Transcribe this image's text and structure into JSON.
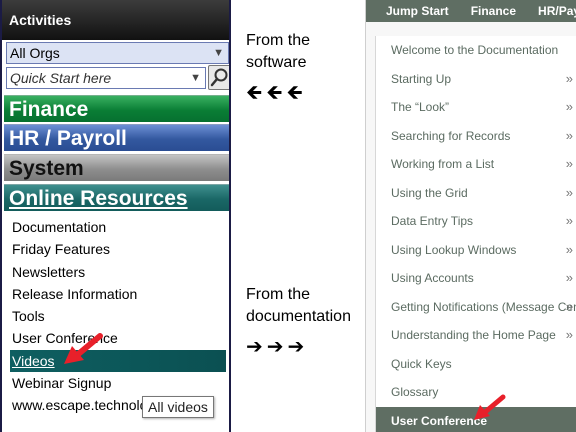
{
  "software": {
    "header_title": "Activities",
    "org_select_value": "All Orgs",
    "quick_start_placeholder": "Quick Start here",
    "categories": [
      {
        "label": "Finance"
      },
      {
        "label": "HR / Payroll"
      },
      {
        "label": "System"
      },
      {
        "label": "Online Resources"
      }
    ],
    "resources": [
      {
        "label": "Documentation"
      },
      {
        "label": "Friday Features"
      },
      {
        "label": "Newsletters"
      },
      {
        "label": "Release Information"
      },
      {
        "label": "Tools"
      },
      {
        "label": "User Conference"
      },
      {
        "label": "Videos",
        "selected": true
      },
      {
        "label": "Webinar Signup"
      },
      {
        "label": "www.escape.technology"
      }
    ],
    "tooltip": "All videos",
    "colors": {
      "finance": "#0a7e35",
      "hr": "#33589f",
      "system": "#8e8e8e",
      "online": "#1a6766",
      "selected": "#0e5f61"
    }
  },
  "captions": {
    "software": [
      "From the",
      "software"
    ],
    "documentation": [
      "From the",
      "documentation"
    ],
    "arrows_left": "🡸🡸🡸",
    "arrows_right": "➔➔➔"
  },
  "documentation": {
    "top_nav": [
      "Jump Start",
      "Finance",
      "HR/Payroll"
    ],
    "menu": [
      {
        "label": "Welcome to the Documentation",
        "has_submenu": false
      },
      {
        "label": "Starting Up",
        "has_submenu": true
      },
      {
        "label": "The “Look”",
        "has_submenu": true
      },
      {
        "label": "Searching for Records",
        "has_submenu": true
      },
      {
        "label": "Working from a List",
        "has_submenu": true
      },
      {
        "label": "Using the Grid",
        "has_submenu": true
      },
      {
        "label": "Data Entry Tips",
        "has_submenu": true
      },
      {
        "label": "Using Lookup Windows",
        "has_submenu": true
      },
      {
        "label": "Using Accounts",
        "has_submenu": true
      },
      {
        "label": "Getting Notifications (Message Center)",
        "has_submenu": true
      },
      {
        "label": "Understanding the Home Page",
        "has_submenu": true
      },
      {
        "label": "Quick Keys",
        "has_submenu": false
      },
      {
        "label": "Glossary",
        "has_submenu": false
      },
      {
        "label": "User Conference",
        "has_submenu": false,
        "active": true
      }
    ],
    "chevron": "»",
    "colors": {
      "nav": "#5f6e63",
      "text": "#5b6b61"
    }
  },
  "callout_color": "#e8202a"
}
